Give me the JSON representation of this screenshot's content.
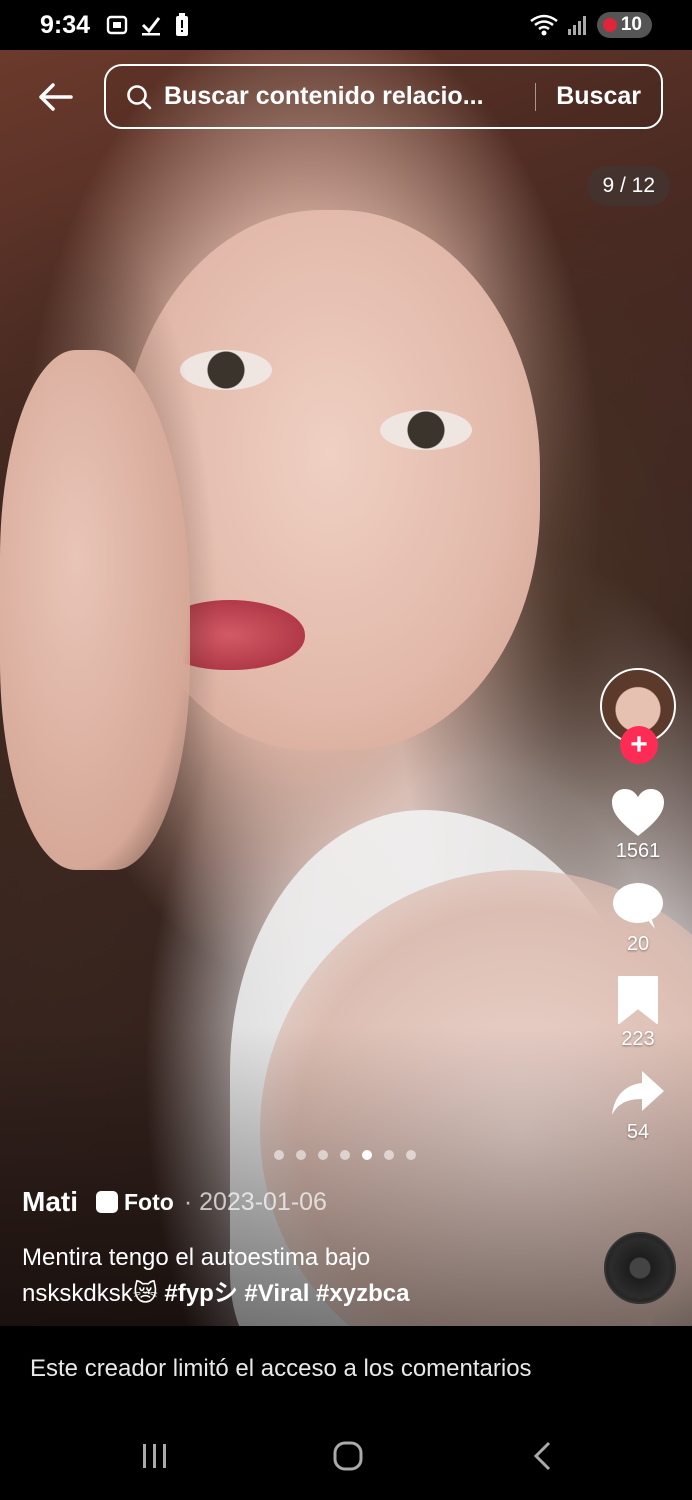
{
  "status_bar": {
    "time": "9:34",
    "battery": "10"
  },
  "search": {
    "text": "Buscar contenido relacio...",
    "button_label": "Buscar"
  },
  "counter": "9 / 12",
  "actions": {
    "likes": "1561",
    "comments": "20",
    "saves": "223",
    "shares": "54"
  },
  "post": {
    "author": "Mati",
    "type_label": "Foto",
    "date": "· 2023-01-06",
    "caption_line1": "Mentira tengo el autoestima bajo",
    "caption_line2": "nskskdksk😿",
    "hashtags": [
      "#fypシ",
      "#Viral",
      "#xyzbca"
    ]
  },
  "carousel": {
    "total_dots": 7,
    "active_index": 4
  },
  "comments_notice": "Este creador limitó el acceso a los comentarios",
  "colors": {
    "follow_accent": "#fe2c55",
    "battery_dot": "#e0243a"
  }
}
